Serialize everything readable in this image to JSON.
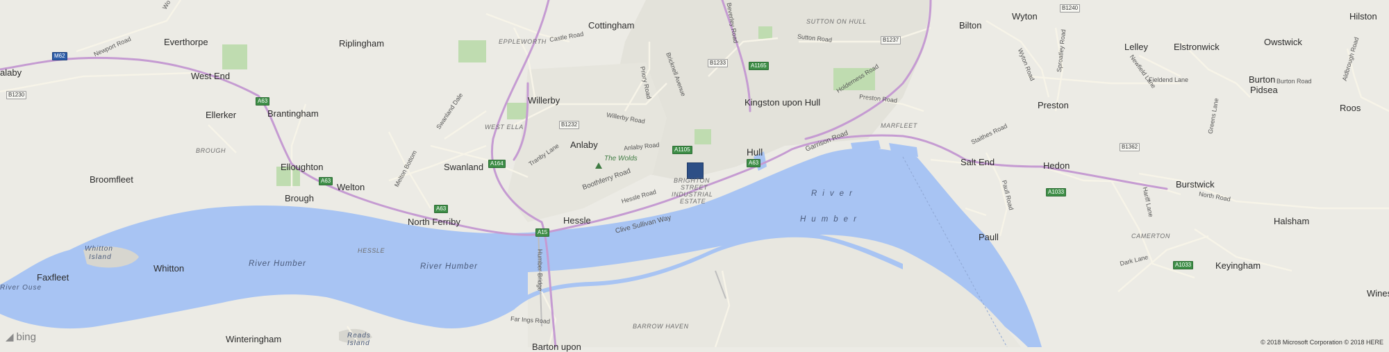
{
  "map": {
    "towns": [
      {
        "key": "cottingham",
        "text": "Cottingham"
      },
      {
        "key": "everthorpe",
        "text": "Everthorpe"
      },
      {
        "key": "riplingham",
        "text": "Riplingham"
      },
      {
        "key": "west_end",
        "text": "West End"
      },
      {
        "key": "ellerker",
        "text": "Ellerker"
      },
      {
        "key": "brantingham",
        "text": "Brantingham"
      },
      {
        "key": "willerby",
        "text": "Willerby"
      },
      {
        "key": "anlaby",
        "text": "Anlaby"
      },
      {
        "key": "swanland",
        "text": "Swanland"
      },
      {
        "key": "elloughton",
        "text": "Elloughton"
      },
      {
        "key": "welton",
        "text": "Welton"
      },
      {
        "key": "brough",
        "text": "Brough"
      },
      {
        "key": "broomfleet",
        "text": "Broomfleet"
      },
      {
        "key": "north_ferriby",
        "text": "North Ferriby"
      },
      {
        "key": "hessle",
        "text": "Hessle"
      },
      {
        "key": "hull",
        "text": "Hull"
      },
      {
        "key": "kingston",
        "text": "Kingston upon Hull"
      },
      {
        "key": "bilton",
        "text": "Bilton"
      },
      {
        "key": "wyton",
        "text": "Wyton"
      },
      {
        "key": "hilston",
        "text": "Hilston"
      },
      {
        "key": "lelley",
        "text": "Lelley"
      },
      {
        "key": "elstronwick",
        "text": "Elstronwick"
      },
      {
        "key": "owstwick",
        "text": "Owstwick"
      },
      {
        "key": "burton_pidsea_1",
        "text": "Burton"
      },
      {
        "key": "burton_pidsea_2",
        "text": "Pidsea"
      },
      {
        "key": "roos",
        "text": "Roos"
      },
      {
        "key": "preston",
        "text": "Preston"
      },
      {
        "key": "salt_end",
        "text": "Salt End"
      },
      {
        "key": "hedon",
        "text": "Hedon"
      },
      {
        "key": "burstwick",
        "text": "Burstwick"
      },
      {
        "key": "halsham",
        "text": "Halsham"
      },
      {
        "key": "paull",
        "text": "Paull"
      },
      {
        "key": "keyingham",
        "text": "Keyingham"
      },
      {
        "key": "wines",
        "text": "Wines"
      },
      {
        "key": "faxfleet",
        "text": "Faxfleet"
      },
      {
        "key": "whitton",
        "text": "Whitton"
      },
      {
        "key": "winteringham",
        "text": "Winteringham"
      },
      {
        "key": "barton",
        "text": "Barton upon"
      },
      {
        "key": "alaby",
        "text": "alaby"
      }
    ],
    "districts": [
      {
        "key": "sutton",
        "text": "SUTTON ON HULL"
      },
      {
        "key": "epplewor",
        "text": "EPPLEWORTH"
      },
      {
        "key": "west_ella",
        "text": "WEST ELLA"
      },
      {
        "key": "brough_d",
        "text": "BROUGH"
      },
      {
        "key": "hessle_d",
        "text": "HESSLE"
      },
      {
        "key": "marfleet",
        "text": "MARFLEET"
      },
      {
        "key": "camerton",
        "text": "CAMERTON"
      },
      {
        "key": "barrow_haven",
        "text": "BARROW HAVEN"
      },
      {
        "key": "brighton_1",
        "text": "BRIGHTON"
      },
      {
        "key": "brighton_2",
        "text": "STREET"
      },
      {
        "key": "brighton_3",
        "text": "INDUSTRIAL"
      },
      {
        "key": "brighton_4",
        "text": "ESTATE"
      }
    ],
    "roads": [
      {
        "key": "newport",
        "text": "Newport Road"
      },
      {
        "key": "castle",
        "text": "Castle Road"
      },
      {
        "key": "beverley",
        "text": "Beverley Road"
      },
      {
        "key": "sutton_rd",
        "text": "Sutton Road"
      },
      {
        "key": "holderness",
        "text": "Holderness Road"
      },
      {
        "key": "preston_rd",
        "text": "Preston Road"
      },
      {
        "key": "bricknell",
        "text": "Bricknell Avenue"
      },
      {
        "key": "priory",
        "text": "Priory Road"
      },
      {
        "key": "willerby_rd",
        "text": "Willerby Road"
      },
      {
        "key": "anlaby_rd",
        "text": "Anlaby Road"
      },
      {
        "key": "swanland_dale",
        "text": "Swanland Dale"
      },
      {
        "key": "tranby",
        "text": "Tranby Lane"
      },
      {
        "key": "boothferry",
        "text": "Boothferry Road"
      },
      {
        "key": "hessle_rd",
        "text": "Hessle Road"
      },
      {
        "key": "clive",
        "text": "Clive Sullivan Way"
      },
      {
        "key": "garrison",
        "text": "Garrison Road"
      },
      {
        "key": "melton",
        "text": "Melton Bottom"
      },
      {
        "key": "wyton_rd",
        "text": "Wyton Road"
      },
      {
        "key": "sproatley",
        "text": "Sproatley Road"
      },
      {
        "key": "newfield",
        "text": "Newfield Lane"
      },
      {
        "key": "fieldend",
        "text": "Fieldend Lane"
      },
      {
        "key": "burton_rd",
        "text": "Burton Road"
      },
      {
        "key": "aldbrough",
        "text": "Aldbrough Road"
      },
      {
        "key": "staithes",
        "text": "Staithes Road"
      },
      {
        "key": "paull_rd",
        "text": "Paull Road"
      },
      {
        "key": "greens",
        "text": "Greens Lane"
      },
      {
        "key": "north_rd",
        "text": "North Road"
      },
      {
        "key": "hariff",
        "text": "Hariff Lane"
      },
      {
        "key": "dark",
        "text": "Dark Lane"
      },
      {
        "key": "far_ings",
        "text": "Far Ings Road"
      },
      {
        "key": "humber_bridge",
        "text": "Humber Bridge"
      },
      {
        "key": "wolds_rd",
        "text": "Wo"
      }
    ],
    "shields": [
      {
        "key": "m62",
        "text": "M62",
        "type": "motorway"
      },
      {
        "key": "b1230",
        "text": "B1230",
        "type": "b"
      },
      {
        "key": "a63_a",
        "text": "A63",
        "type": "a"
      },
      {
        "key": "a63_b",
        "text": "A63",
        "type": "a"
      },
      {
        "key": "a63_c",
        "text": "A63",
        "type": "a"
      },
      {
        "key": "a63_d",
        "text": "A63",
        "type": "a"
      },
      {
        "key": "a164",
        "text": "A164",
        "type": "a"
      },
      {
        "key": "a15",
        "text": "A15",
        "type": "a"
      },
      {
        "key": "b1232",
        "text": "B1232",
        "type": "b"
      },
      {
        "key": "a1105",
        "text": "A1105",
        "type": "a"
      },
      {
        "key": "b1233",
        "text": "B1233",
        "type": "b"
      },
      {
        "key": "a1165",
        "text": "A1165",
        "type": "a"
      },
      {
        "key": "b1237",
        "text": "B1237",
        "type": "b"
      },
      {
        "key": "b1240",
        "text": "B1240",
        "type": "b"
      },
      {
        "key": "b1362",
        "text": "B1362",
        "type": "b"
      },
      {
        "key": "a1033_a",
        "text": "A1033",
        "type": "a"
      },
      {
        "key": "a1033_b",
        "text": "A1033",
        "type": "a"
      }
    ],
    "water": [
      {
        "key": "river_humber_1",
        "text": "River Humber"
      },
      {
        "key": "river_humber_2",
        "text": "River Humber"
      },
      {
        "key": "river_1",
        "text": "River"
      },
      {
        "key": "humber_2",
        "text": "Humber"
      },
      {
        "key": "whitton_island_1",
        "text": "Whitton"
      },
      {
        "key": "whitton_island_2",
        "text": "Island"
      },
      {
        "key": "river_ouse",
        "text": "River Ouse"
      },
      {
        "key": "reads_1",
        "text": "Reads"
      },
      {
        "key": "reads_2",
        "text": "Island"
      }
    ],
    "landmarks": [
      {
        "key": "wolds",
        "text": "The Wolds"
      }
    ]
  },
  "attribution": {
    "logo_text": "bing",
    "copyright": "© 2018 Microsoft Corporation © 2018 HERE"
  },
  "colors": {
    "land": "#ecebe5",
    "water": "#a8c4f3",
    "urban": "#e2e1d9",
    "park": "#b7d8a7",
    "major_road": "#c99bd5",
    "minor_road": "#f6f3e8",
    "pin": "#2d4f86"
  }
}
